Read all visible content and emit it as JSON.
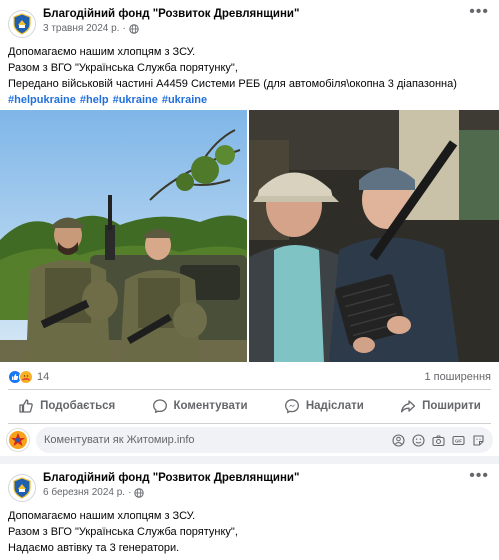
{
  "post1": {
    "page_name": "Благодійний фонд \"Розвиток Древлянщини\"",
    "date": "3 травня 2024 р.",
    "lines": [
      "Допомагаємо нашим хлопцям з ЗСУ.",
      "Разом з ВГО \"Українська Служба порятунку\",",
      "Передано військовій частині А4459 Системи РЕБ (для автомобіля\\окопна 3 діапазонна)"
    ],
    "hashtags": [
      "#helpukraine",
      "#help",
      "#ukraine",
      "#ukraine"
    ],
    "reaction_count": "14",
    "shares": "1 поширення",
    "actions": {
      "like": "Подобається",
      "comment": "Коментувати",
      "send": "Надіслати",
      "share": "Поширити"
    },
    "comment_placeholder": "Коментувати як Житомир.info"
  },
  "post2": {
    "page_name": "Благодійний фонд \"Розвиток Древлянщини\"",
    "date": "6 березня 2024 р.",
    "lines": [
      "Допомагаємо нашим хлопцям з ЗСУ.",
      "Разом з ВГО \"Українська Служба порятунку\",",
      "Надаємо автівку та 3 генератори."
    ]
  },
  "icons": {
    "more": "more-options-icon",
    "audience": "globe-icon",
    "like": "thumbs-up-icon",
    "comment": "speech-bubble-icon",
    "send": "messenger-icon",
    "share": "share-arrow-icon"
  },
  "colors": {
    "link": "#216fdb",
    "like_blue": "#1877f2",
    "muted": "#65676b"
  }
}
